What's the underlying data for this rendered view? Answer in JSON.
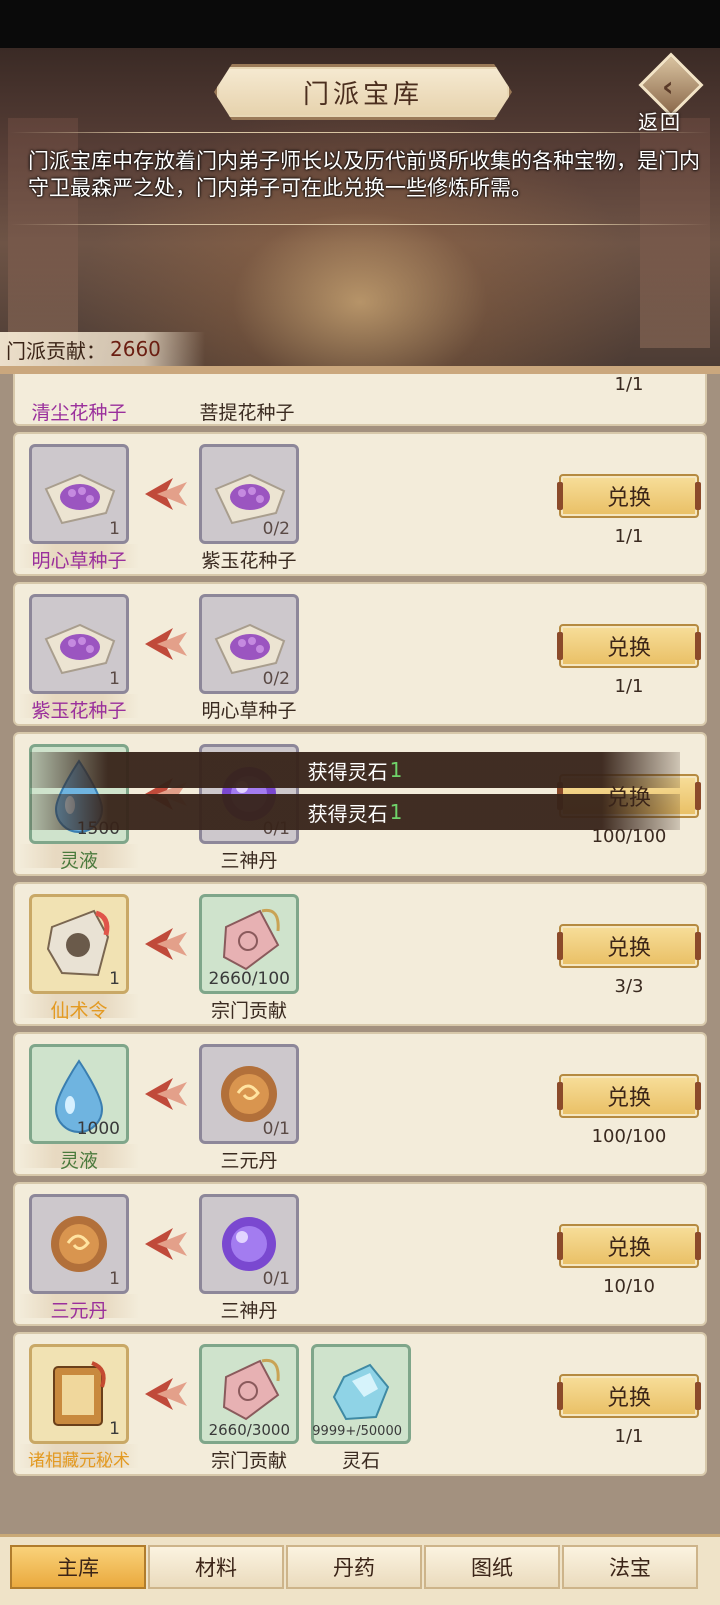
{
  "header": {
    "title": "门派宝库",
    "back_label": "返回",
    "description": "门派宝库中存放着门内弟子师长以及历代前贤所收集的各种宝物，是门内守卫最森严之处，门内弟子可在此兑换一些修炼所需。",
    "contribution_label": "门派贡献：",
    "contribution_value": "2660"
  },
  "rows": [
    {
      "reward": {
        "name": "清尘花种子"
      },
      "costs": [
        {
          "name": "菩提花种子"
        }
      ],
      "limit": "1/1"
    },
    {
      "reward": {
        "name": "明心草种子",
        "count": "1"
      },
      "costs": [
        {
          "name": "紫玉花种子",
          "count": "0/2"
        }
      ],
      "button": "兑换",
      "limit": "1/1"
    },
    {
      "reward": {
        "name": "紫玉花种子",
        "count": "1"
      },
      "costs": [
        {
          "name": "明心草种子",
          "count": "0/2"
        }
      ],
      "button": "兑换",
      "limit": "1/1"
    },
    {
      "reward": {
        "name": "灵液",
        "count": "1500"
      },
      "costs": [
        {
          "name": "三神丹",
          "count": "0/1"
        }
      ],
      "button": "兑换",
      "limit": "100/100"
    },
    {
      "reward": {
        "name": "仙术令",
        "count": "1"
      },
      "costs": [
        {
          "name": "宗门贡献",
          "count": "2660/100"
        }
      ],
      "button": "兑换",
      "limit": "3/3"
    },
    {
      "reward": {
        "name": "灵液",
        "count": "1000"
      },
      "costs": [
        {
          "name": "三元丹",
          "count": "0/1"
        }
      ],
      "button": "兑换",
      "limit": "100/100"
    },
    {
      "reward": {
        "name": "三元丹",
        "count": "1"
      },
      "costs": [
        {
          "name": "三神丹",
          "count": "0/1"
        }
      ],
      "button": "兑换",
      "limit": "10/10"
    },
    {
      "reward": {
        "name": "诸相藏元秘术",
        "count": "1"
      },
      "costs": [
        {
          "name": "宗门贡献",
          "count": "2660/3000"
        },
        {
          "name": "灵石",
          "count": "9999+/50000"
        }
      ],
      "button": "兑换",
      "limit": "1/1"
    }
  ],
  "toasts": [
    {
      "text": "获得灵石",
      "num": "1"
    },
    {
      "text": "获得灵石",
      "num": "1"
    }
  ],
  "tabs": [
    "主库",
    "材料",
    "丹药",
    "图纸",
    "法宝"
  ],
  "active_tab": "主库",
  "colors": {
    "accent": "#e9bf64",
    "purple_name": "#9a2f9c",
    "green_name": "#4a7a3d",
    "orange_name": "#e39a22"
  }
}
